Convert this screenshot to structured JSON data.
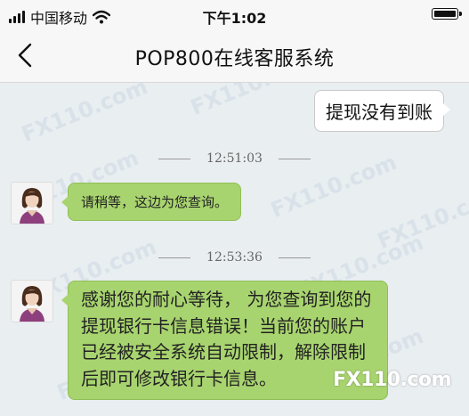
{
  "status_bar": {
    "carrier": "中国移动",
    "time": "下午1:02"
  },
  "nav": {
    "title": "POP800在线客服系统"
  },
  "messages": [
    {
      "type": "user",
      "text": "提现没有到账"
    },
    {
      "type": "time",
      "text": "12:51:03"
    },
    {
      "type": "agent",
      "text": "请稍等，这边为您查询。"
    },
    {
      "type": "time",
      "text": "12:53:36"
    },
    {
      "type": "agent",
      "text": "感谢您的耐心等待， 为您查询到您的提现银行卡信息错误！当前您的账户已经被安全系统自动限制，解除限制后即可修改银行卡信息。"
    }
  ],
  "watermark": {
    "text": "FX110.com",
    "brand": "FX110.com"
  },
  "colors": {
    "agent_bubble": "#a8d46f",
    "user_bubble": "#ffffff",
    "chat_background": "#e9eef1"
  },
  "icons": [
    "signal-icon",
    "wifi-icon",
    "battery-icon",
    "back-chevron-icon",
    "agent-avatar-icon"
  ]
}
